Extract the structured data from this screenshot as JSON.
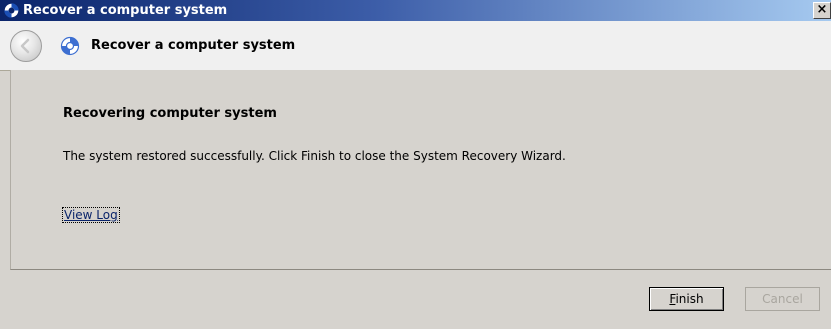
{
  "window": {
    "title": "Recover a computer system",
    "close_glyph": "×"
  },
  "header": {
    "title": "Recover a computer system",
    "back_icon": "back-arrow-icon",
    "wizard_icon": "lifebuoy-icon"
  },
  "content": {
    "heading": "Recovering computer system",
    "message": "The system restored successfully. Click Finish to close the System Recovery Wizard.",
    "view_log_link": "View Log"
  },
  "buttons": {
    "finish_mnemonic": "F",
    "finish_rest": "inish",
    "cancel_label": "Cancel",
    "cancel_enabled": false
  },
  "colors": {
    "titlebar_start": "#0a246a",
    "titlebar_end": "#a6caf0",
    "dialog_bg": "#d6d3ce",
    "link": "#0a246a"
  }
}
